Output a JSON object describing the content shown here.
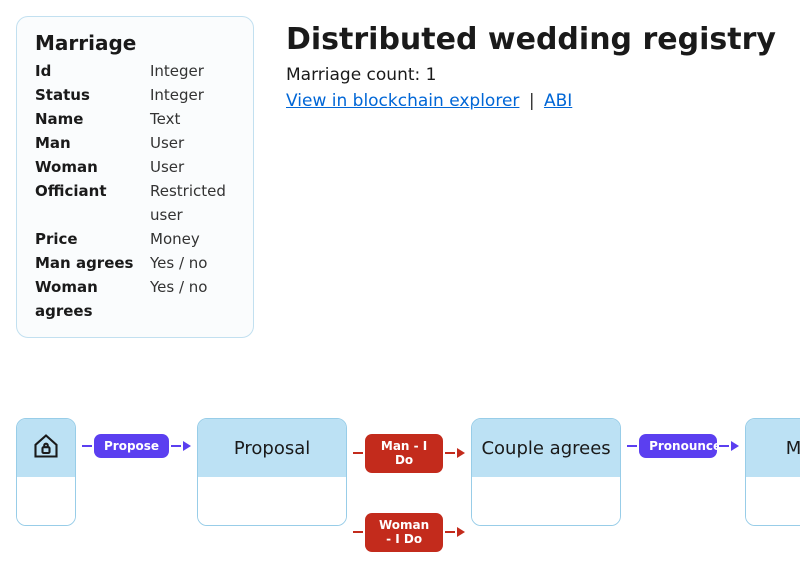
{
  "card": {
    "title": "Marriage",
    "fields": [
      {
        "label": "Id",
        "type": "Integer"
      },
      {
        "label": "Status",
        "type": "Integer"
      },
      {
        "label": "Name",
        "type": "Text"
      },
      {
        "label": "Man",
        "type": "User"
      },
      {
        "label": "Woman",
        "type": "User"
      },
      {
        "label": "Officiant",
        "type": "Restricted user"
      },
      {
        "label": "Price",
        "type": "Money"
      },
      {
        "label": "Man agrees",
        "type": "Yes / no"
      },
      {
        "label": "Woman agrees",
        "type": "Yes / no"
      }
    ]
  },
  "header": {
    "title": "Distributed wedding registry",
    "count_label": "Marriage count: ",
    "count_value": "1",
    "link_explorer": "View in blockchain explorer",
    "link_abi": "ABI"
  },
  "flow": {
    "states": {
      "s0_icon": "lock-house-icon",
      "s1": "Proposal",
      "s2": "Couple agrees",
      "s3": "Married"
    },
    "arrows": {
      "a0": {
        "label": "Propose",
        "color": "purple"
      },
      "a1": {
        "label": "Man - I Do",
        "color": "red"
      },
      "a2": {
        "label": "Woman - I Do",
        "color": "red"
      },
      "a3": {
        "label": "Pronounce",
        "color": "purple"
      }
    }
  }
}
